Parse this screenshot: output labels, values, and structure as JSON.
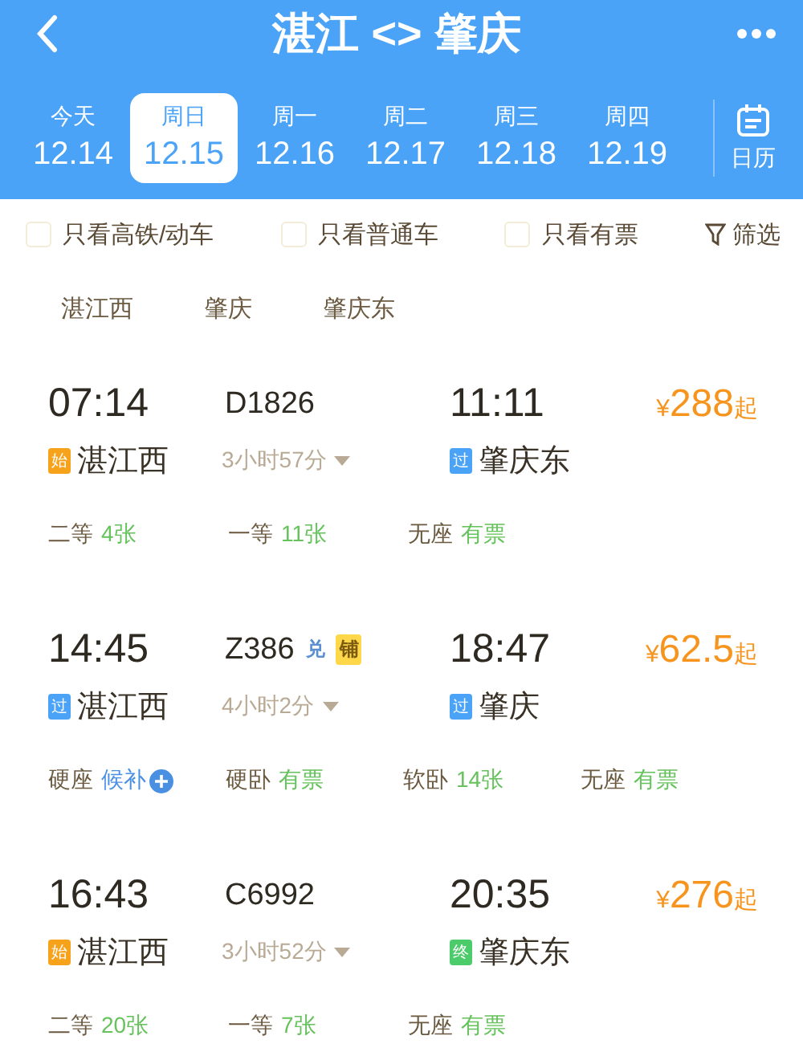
{
  "header": {
    "title": "湛江 <> 肇庆"
  },
  "dates": [
    {
      "weekday": "今天",
      "date": "12.14",
      "selected": false
    },
    {
      "weekday": "周日",
      "date": "12.15",
      "selected": true
    },
    {
      "weekday": "周一",
      "date": "12.16",
      "selected": false
    },
    {
      "weekday": "周二",
      "date": "12.17",
      "selected": false
    },
    {
      "weekday": "周三",
      "date": "12.18",
      "selected": false
    },
    {
      "weekday": "周四",
      "date": "12.19",
      "selected": false
    }
  ],
  "calendar": {
    "label": "日历"
  },
  "filters": [
    {
      "label": "只看高铁/动车",
      "checked": false
    },
    {
      "label": "只看普通车",
      "checked": false
    },
    {
      "label": "只看有票",
      "checked": false
    }
  ],
  "filter_button": {
    "label": "筛选"
  },
  "stations": [
    "湛江西",
    "肇庆",
    "肇庆东"
  ],
  "trains": [
    {
      "depart": "07:14",
      "number": "D1826",
      "arrive": "11:11",
      "price_symbol": "¥",
      "price": "288",
      "price_suffix": "起",
      "from_badge": {
        "text": "始",
        "kind": "start"
      },
      "from": "湛江西",
      "duration": "3小时57分",
      "to_badge": {
        "text": "过",
        "kind": "pass"
      },
      "to": "肇庆东",
      "seats": [
        {
          "label": "二等",
          "value": "4张",
          "kind": "available"
        },
        {
          "label": "一等",
          "value": "11张",
          "kind": "available"
        },
        {
          "label": "无座",
          "value": "有票",
          "kind": "available"
        }
      ]
    },
    {
      "depart": "14:45",
      "number": "Z386",
      "tags": [
        {
          "text": "兑",
          "kind": "plain"
        },
        {
          "text": "铺",
          "kind": "filled"
        }
      ],
      "arrive": "18:47",
      "price_symbol": "¥",
      "price": "62.5",
      "price_suffix": "起",
      "from_badge": {
        "text": "过",
        "kind": "pass"
      },
      "from": "湛江西",
      "duration": "4小时2分",
      "to_badge": {
        "text": "过",
        "kind": "pass"
      },
      "to": "肇庆",
      "seats": [
        {
          "label": "硬座",
          "value": "候补",
          "kind": "waitlist"
        },
        {
          "label": "硬卧",
          "value": "有票",
          "kind": "available"
        },
        {
          "label": "软卧",
          "value": "14张",
          "kind": "available"
        },
        {
          "label": "无座",
          "value": "有票",
          "kind": "available"
        }
      ]
    },
    {
      "depart": "16:43",
      "number": "C6992",
      "arrive": "20:35",
      "price_symbol": "¥",
      "price": "276",
      "price_suffix": "起",
      "from_badge": {
        "text": "始",
        "kind": "start"
      },
      "from": "湛江西",
      "duration": "3小时52分",
      "to_badge": {
        "text": "终",
        "kind": "end"
      },
      "to": "肇庆东",
      "seats": [
        {
          "label": "二等",
          "value": "20张",
          "kind": "available"
        },
        {
          "label": "一等",
          "value": "7张",
          "kind": "available"
        },
        {
          "label": "无座",
          "value": "有票",
          "kind": "available"
        }
      ]
    }
  ]
}
